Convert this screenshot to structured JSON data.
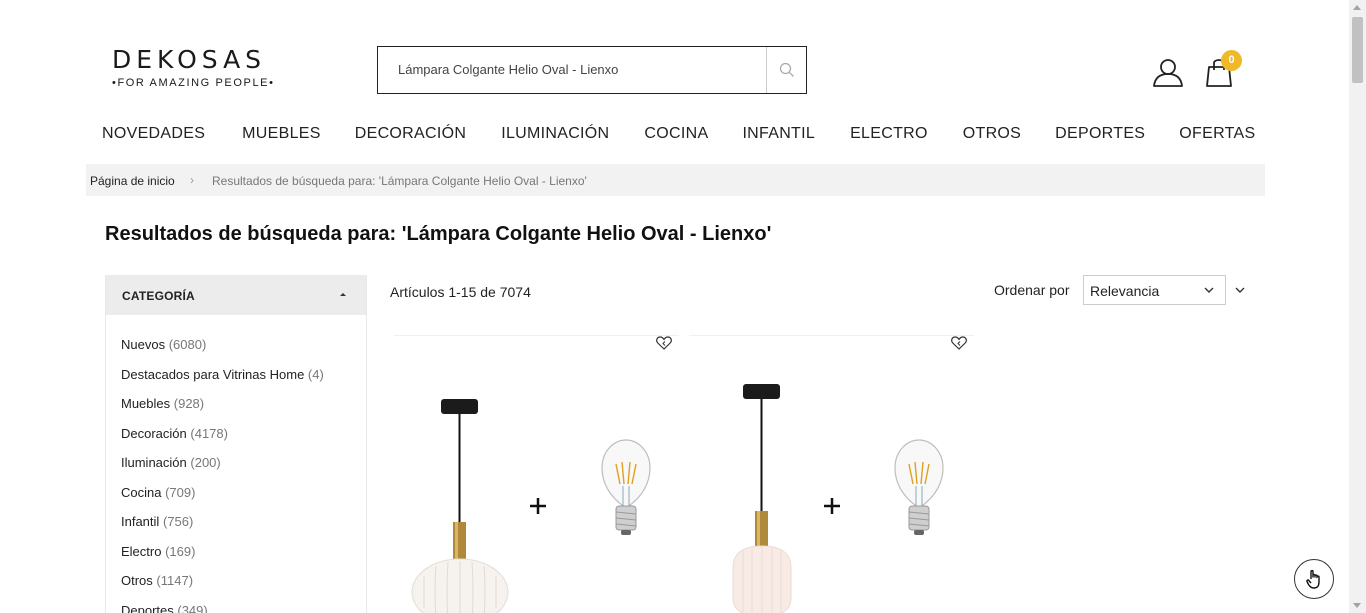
{
  "header": {
    "logo_brand": "DEKOSAS",
    "logo_tagline": "•FOR AMAZING PEOPLE•",
    "search_value": "Lámpara Colgante Helio Oval - Lienxo",
    "cart_count": "0",
    "icons": {
      "search": "search-icon",
      "user": "user-icon",
      "cart": "shopping-bag-icon"
    },
    "accent_color": "#f0b928"
  },
  "nav": {
    "items": [
      "NOVEDADES",
      "MUEBLES",
      "DECORACIÓN",
      "ILUMINACIÓN",
      "COCINA",
      "INFANTIL",
      "ELECTRO",
      "OTROS",
      "DEPORTES",
      "OFERTAS"
    ]
  },
  "breadcrumb": {
    "home": "Página de inicio",
    "separator": "›",
    "current": "Resultados de búsqueda para: 'Lámpara Colgante Helio Oval - Lienxo'"
  },
  "page_title": "Resultados de búsqueda para: 'Lámpara Colgante Helio Oval - Lienxo'",
  "sidebar": {
    "heading": "CATEGORÍA",
    "items": [
      {
        "label": "Nuevos",
        "count": "(6080)"
      },
      {
        "label": "Destacados para Vitrinas Home",
        "count": "(4)"
      },
      {
        "label": "Muebles",
        "count": "(928)"
      },
      {
        "label": "Decoración",
        "count": "(4178)"
      },
      {
        "label": "Iluminación",
        "count": "(200)"
      },
      {
        "label": "Cocina",
        "count": "(709)"
      },
      {
        "label": "Infantil",
        "count": "(756)"
      },
      {
        "label": "Electro",
        "count": "(169)"
      },
      {
        "label": "Otros",
        "count": "(1147)"
      },
      {
        "label": "Deportes",
        "count": "(349)"
      }
    ]
  },
  "toolbar": {
    "amount": "Artículos 1-15 de 7074",
    "sort_label": "Ordenar por",
    "sort_value": "Relevancia"
  },
  "products": [
    {
      "wishlist_icon": "heart-icon"
    },
    {
      "wishlist_icon": "heart-icon"
    }
  ]
}
